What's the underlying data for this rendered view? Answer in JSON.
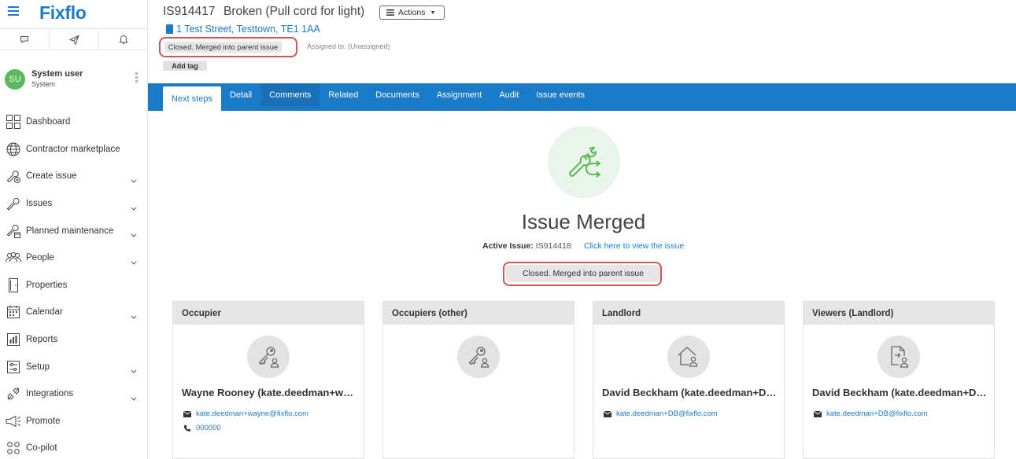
{
  "app": {
    "logo": "Fixflo"
  },
  "user": {
    "initials": "SU",
    "name": "System user",
    "role": "System"
  },
  "nav": [
    {
      "label": "Dashboard",
      "icon": "dashboard-icon",
      "expandable": false
    },
    {
      "label": "Contractor marketplace",
      "icon": "globe-icon",
      "expandable": false
    },
    {
      "label": "Create issue",
      "icon": "wrench-plus-icon",
      "expandable": true
    },
    {
      "label": "Issues",
      "icon": "wrench-icon",
      "expandable": true
    },
    {
      "label": "Planned maintenance",
      "icon": "wrench-calendar-icon",
      "expandable": true
    },
    {
      "label": "People",
      "icon": "people-icon",
      "expandable": true
    },
    {
      "label": "Properties",
      "icon": "door-icon",
      "expandable": false
    },
    {
      "label": "Calendar",
      "icon": "calendar-icon",
      "expandable": true
    },
    {
      "label": "Reports",
      "icon": "reports-icon",
      "expandable": false
    },
    {
      "label": "Setup",
      "icon": "settings-icon",
      "expandable": true
    },
    {
      "label": "Integrations",
      "icon": "integrations-icon",
      "expandable": true
    },
    {
      "label": "Promote",
      "icon": "megaphone-icon",
      "expandable": false
    },
    {
      "label": "Co-pilot",
      "icon": "copilot-icon",
      "expandable": false
    }
  ],
  "issue": {
    "id": "IS914417",
    "title": "Broken (Pull cord for light)",
    "actions_label": "Actions",
    "address": "1 Test Street, Testtown, TE1 1AA",
    "status": "Closed. Merged into parent issue",
    "assigned": "Assigned to: (Unassigned)",
    "add_tag": "Add tag"
  },
  "tabs": [
    "Next steps",
    "Detail",
    "Comments",
    "Related",
    "Documents",
    "Assignment",
    "Audit",
    "Issue events"
  ],
  "main": {
    "heading": "Issue Merged",
    "active_label": "Active Issue:",
    "active_value": "IS914418",
    "view_link": "Click here to view the issue",
    "status": "Closed. Merged into parent issue"
  },
  "cards": [
    {
      "title": "Occupier",
      "icon": "key-person-icon",
      "name": "Wayne Rooney (kate.deedman+wayne@fixflo.com)",
      "email": "kate.deedman+wayne@fixflo.com",
      "phone": "000000"
    },
    {
      "title": "Occupiers (other)",
      "icon": "key-person-icon",
      "name": "",
      "email": "",
      "phone": ""
    },
    {
      "title": "Landlord",
      "icon": "house-person-icon",
      "name": "David Beckham (kate.deedman+DB@fixflo.com)",
      "email": "kate.deedman+DB@fixflo.com",
      "phone": ""
    },
    {
      "title": "Viewers (Landlord)",
      "icon": "document-person-icon",
      "name": "David Beckham (kate.deedman+DB@fixflo.com)",
      "email": "kate.deedman+DB@fixflo.com",
      "phone": ""
    }
  ],
  "colors": {
    "brand": "#1a7bc8",
    "status_ring": "#d9534f",
    "merge_bg": "#e9f5e9",
    "merge_icon": "#5cb85c"
  }
}
